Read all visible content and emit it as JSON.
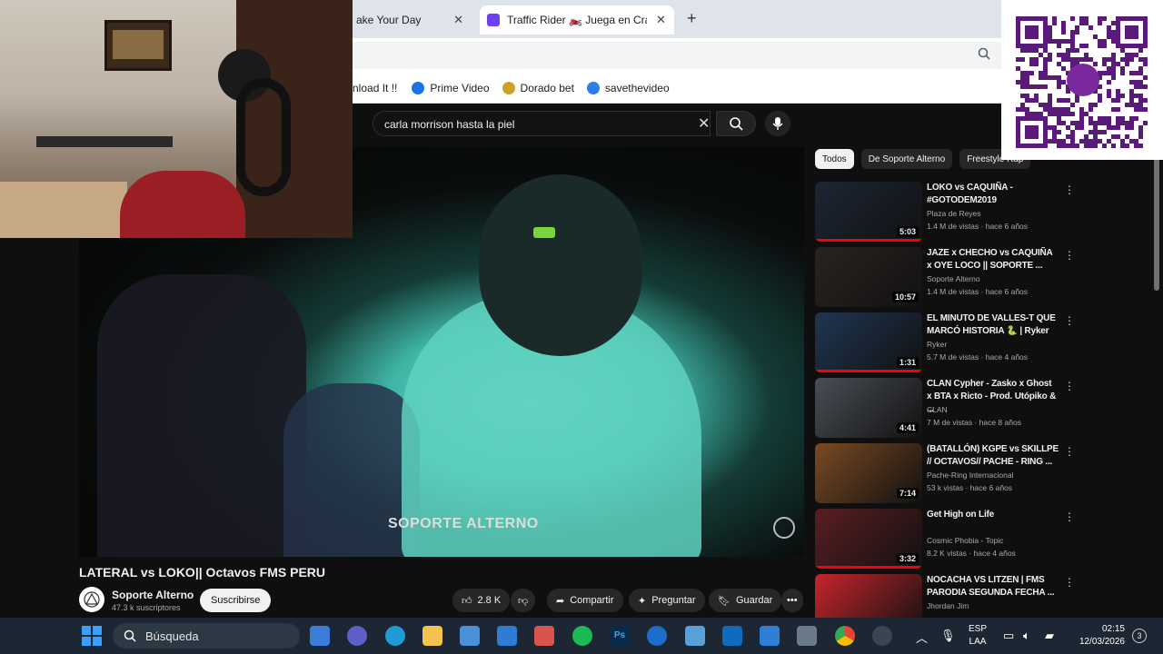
{
  "browser": {
    "tabs": [
      {
        "label": "ake Your Day",
        "close": "✕"
      },
      {
        "label": "Traffic Rider 🏍️ Juega en Crazy",
        "close": "✕"
      }
    ],
    "new_tab": "+",
    "bookmarks": [
      {
        "label": "nload It !!",
        "color": "#444444"
      },
      {
        "label": "Prime Video",
        "color": "#1a73e8"
      },
      {
        "label": "Dorado bet",
        "color": "#c9a227"
      },
      {
        "label": "savethevideo",
        "color": "#2e7de8"
      }
    ]
  },
  "youtube": {
    "search_value": "carla morrison hasta la piel",
    "clear": "✕",
    "video": {
      "watermark": "SOPORTE ALTERNO",
      "title": "LATERAL vs LOKO|| Octavos FMS PERU"
    },
    "channel": {
      "name": "Soporte Alterno",
      "subs": "47.3 k suscriptores",
      "subscribe": "Suscribirse"
    },
    "actions": {
      "likes": "2.8 K",
      "share": "Compartir",
      "ask": "Preguntar",
      "save": "Guardar",
      "more": "•••"
    },
    "chips": [
      "Todos",
      "De Soporte Alterno",
      "Freestyle Rap"
    ],
    "recommendations": [
      {
        "title": "LOKO vs CAQUIÑA - #GOTODEM2019",
        "channel": "Plaza de Reyes",
        "meta": "1.4 M de vistas · hace 6 años",
        "duration": "5:03",
        "thumb_color": "#1d2634",
        "watched": true
      },
      {
        "title": "JAZE x CHECHO vs CAQUIÑA x OYE LOCO || SOPORTE ...",
        "channel": "Soporte Alterno",
        "meta": "1.4 M de vistas · hace 6 años",
        "duration": "10:57",
        "thumb_color": "#2a2320",
        "watched": false
      },
      {
        "title": "EL MINUTO DE VALLES-T QUE MARCÓ HISTORIA 🐍 | Ryker",
        "channel": "Ryker",
        "meta": "5.7 M de vistas · hace 4 años",
        "duration": "1:31",
        "thumb_color": "#1f3652",
        "watched": true
      },
      {
        "title": "CLAN Cypher - Zasko x Ghost x BTA x Ricto - Prod. Utópiko & ...",
        "channel": "CLAN",
        "meta": "7 M de vistas · hace 8 años",
        "duration": "4:41",
        "thumb_color": "#4a4e55",
        "watched": false
      },
      {
        "title": "(BATALLÓN) KGPE vs SKILLPE // OCTAVOS// PACHE - RING ...",
        "channel": "Pache-Ring Internacional",
        "meta": "53 k vistas · hace 6 años",
        "duration": "7:14",
        "thumb_color": "#7a4a22",
        "watched": false
      },
      {
        "title": "Get High on Life",
        "channel": "Cosmic Phobia - Topic",
        "meta": "8.2 K vistas · hace 4 años",
        "duration": "3:32",
        "thumb_color": "#5a1e22",
        "watched": true
      },
      {
        "title": "NOCACHA VS LITZEN | FMS PARODIA SEGUNDA FECHA ...",
        "channel": "Jhordan Jim",
        "meta": "",
        "duration": "",
        "thumb_color": "#c8252b",
        "watched": false
      }
    ]
  },
  "taskbar": {
    "search_label": "Búsqueda",
    "lang": "ESP",
    "lang_sub": "LAA",
    "time": "02:15",
    "date": "12/03/2026",
    "notifications": "3"
  }
}
